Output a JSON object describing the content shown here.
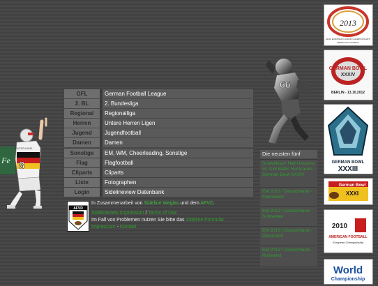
{
  "nav": [
    {
      "abbr": "GFL",
      "full": "German Football League"
    },
    {
      "abbr": "2. BL",
      "full": "2. Bundesliga"
    },
    {
      "abbr": "Regional",
      "full": "Regionalliga"
    },
    {
      "abbr": "Herren",
      "full": "Untere Herren Ligen"
    },
    {
      "abbr": "Jugend",
      "full": "Jugendfootball"
    },
    {
      "abbr": "Damen",
      "full": "Damen"
    },
    {
      "abbr": "Sonstige",
      "full": "EM, WM, Cheerleading, Sonstige"
    },
    {
      "abbr": "Flag",
      "full": "Flagfootball"
    },
    {
      "abbr": "Cliparts",
      "full": "Cliparts"
    },
    {
      "abbr": "Liste",
      "full": "Fotographen"
    },
    {
      "abbr": "Login",
      "full": "Sidelineview Datenbank"
    }
  ],
  "cooperation": {
    "prefix": "In Zusammenarbeit von",
    "link1": "Sideline Weglas",
    "middle": "und dem",
    "link2": "AFVD.",
    "link3": "Sidelineview Impressum",
    "sep": "/",
    "link4": "Terms of Use",
    "problem_text": "Im Fall von Problemen nutzen Sie bitte das",
    "link5": "Sideline Formular.",
    "link6": "Impressum",
    "dash": "-",
    "link7": "Kontakt"
  },
  "afvd_logo_text": "AFVD",
  "player_jersey": "8",
  "player_shirt_text": "DEUTSCHLAND",
  "news": {
    "heading": "Die neusten fünf",
    "items": [
      "Schwäbisch Hall Unicorns vs. Kiel Baltic Hurricanes - German Bowl XXXIV",
      "EM 2013 / Deutschland - Frankreich",
      "EM 2013 / Deutschland - Schweden",
      "EM 2013 / Deutschland - Österreich",
      "EM 2013 / Deutschland - Russland"
    ]
  },
  "banners": {
    "b1": {
      "year": "2013",
      "line1": "EFAF EUROPEAN JUNIOR CHAMPIONSHIPS",
      "line2": "AMERICAN FOOTBALL"
    },
    "b2": {
      "title": "GERMAN BOWL",
      "num": "XXXIV",
      "date": "BERLIN - 13.10.2012"
    },
    "b3": {
      "title": "GERMAN BOWL",
      "num": "XXXIII"
    },
    "b4": {
      "title": "German Bowl",
      "num": "XXXI"
    },
    "b5": {
      "year": "2010",
      "line1": "AMERICAN FOOTBALL",
      "line2": "European Championship"
    },
    "b6": {
      "title": "World",
      "line2": "Championship"
    }
  },
  "colors": {
    "link": "#3fbf3f",
    "nav_abbr_bg": "#6e6e6e",
    "nav_full_bg": "#5a5a5a"
  }
}
